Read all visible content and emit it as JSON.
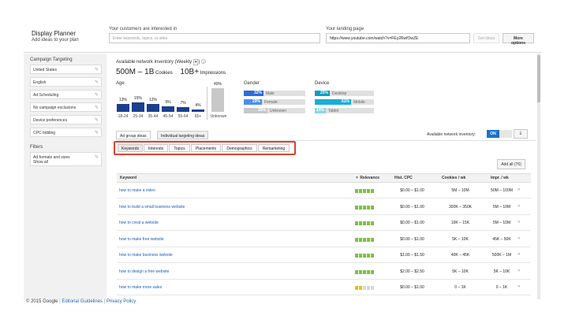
{
  "header": {
    "title": "Display Planner",
    "subtitle": "Add ideas to your plan",
    "interests_label": "Your customers are interested in",
    "interests_placeholder": "Enter keywords, topics, or sites",
    "landing_label": "Your landing page",
    "landing_value": "https://www.youtube.com/watch?v=FEy2RwfOwZE",
    "get_ideas": "Get ideas",
    "more_options": "More options"
  },
  "sidebar": {
    "targeting_heading": "Campaign Targeting",
    "items": [
      {
        "label": "United States"
      },
      {
        "label": "English"
      },
      {
        "label": "Ad Scheduling"
      },
      {
        "label": "No campaign exclusions"
      },
      {
        "label": "Device preferences"
      },
      {
        "label": "CPC bidding"
      }
    ],
    "filters_heading": "Filters",
    "filter_line1": "Ad formats and sizes",
    "filter_line2": "Show all"
  },
  "inventory": {
    "label": "Available network inventory (Weekly",
    "cookies_value": "500M – 1B",
    "cookies_label": "Cookies",
    "impressions_value": "10B+",
    "impressions_label": "Impressions"
  },
  "age": {
    "heading": "Age",
    "groups": [
      {
        "label": "18-24",
        "pct": "13%",
        "value": 13
      },
      {
        "label": "25-34",
        "pct": "15%",
        "value": 15
      },
      {
        "label": "35-44",
        "pct": "12%",
        "value": 12
      },
      {
        "label": "45-54",
        "pct": "9%",
        "value": 9
      },
      {
        "label": "55-64",
        "pct": "7%",
        "value": 7
      },
      {
        "label": "65+",
        "pct": "4%",
        "value": 4
      }
    ],
    "unknown_pct": "40%",
    "unknown_value": 40,
    "unknown_label": "Unknown"
  },
  "gender": {
    "heading": "Gender",
    "rows": [
      {
        "pct": "32%",
        "label": "Male",
        "value": 32,
        "color": "#2a6ed8"
      },
      {
        "pct": "29%",
        "label": "Female",
        "value": 29,
        "color": "#4b8ef0"
      },
      {
        "pct": "39%",
        "label": "Unknown",
        "value": 39,
        "color": "#c8c8c8"
      }
    ]
  },
  "device": {
    "heading": "Device",
    "rows": [
      {
        "pct": "25%",
        "label": "Desktop",
        "value": 25,
        "color": "#0f9ec2"
      },
      {
        "pct": "61%",
        "label": "Mobile",
        "value": 61,
        "color": "#1aaed6"
      },
      {
        "pct": "14%",
        "label": "Tablet",
        "value": 14,
        "color": "#8fd4ea"
      }
    ]
  },
  "tabs": {
    "ad_group": "Ad group ideas",
    "individual": "Individual targeting ideas"
  },
  "toggle": {
    "label": "Available network inventory:",
    "state": "ON"
  },
  "subtabs": [
    "Keywords",
    "Interests",
    "Topics",
    "Placements",
    "Demographics",
    "Remarketing"
  ],
  "add_all": "Add all (76)",
  "table": {
    "headers": {
      "keyword": "Keyword",
      "relevance": "Relevance",
      "cpc": "Hist. CPC",
      "cookies": "Cookies / wk",
      "impr": "Impr. / wk"
    },
    "rows": [
      {
        "keyword": "how to make a video",
        "cpc": "$0.00 – $1.00",
        "cookies": "5M – 10M",
        "impr": "50M – 100M",
        "rel": 5,
        "rel_color": "#7bbf4a"
      },
      {
        "keyword": "how to build a small business website",
        "cpc": "$0.00 – $1.00",
        "cookies": "300K – 350K",
        "impr": "5M – 10M",
        "rel": 5,
        "rel_color": "#7bbf4a"
      },
      {
        "keyword": "how to creat a website",
        "cpc": "$0.00 – $1.00",
        "cookies": "10K – 15K",
        "impr": "5M – 10M",
        "rel": 5,
        "rel_color": "#7bbf4a"
      },
      {
        "keyword": "how to make free website",
        "cpc": "$0.00 – $1.00",
        "cookies": "5K – 10K",
        "impr": "45K – 50K",
        "rel": 5,
        "rel_color": "#7bbf4a"
      },
      {
        "keyword": "how to make business website",
        "cpc": "$1.00 – $1.50",
        "cookies": "40K – 45K",
        "impr": "500K – 1M",
        "rel": 5,
        "rel_color": "#7bbf4a"
      },
      {
        "keyword": "how to design a free website",
        "cpc": "$2.00 – $2.50",
        "cookies": "5K – 10K",
        "impr": "5K – 10K",
        "rel": 5,
        "rel_color": "#7bbf4a"
      },
      {
        "keyword": "how to make more sales",
        "cpc": "$0.00 – $1.00",
        "cookies": "0 – 1K",
        "impr": "0 – 1K",
        "rel": 2,
        "rel_color": "#e0c21a"
      }
    ]
  },
  "footer": {
    "copyright": "© 2015 Google",
    "guidelines": "Editorial Guidelines",
    "privacy": "Privacy Policy"
  }
}
